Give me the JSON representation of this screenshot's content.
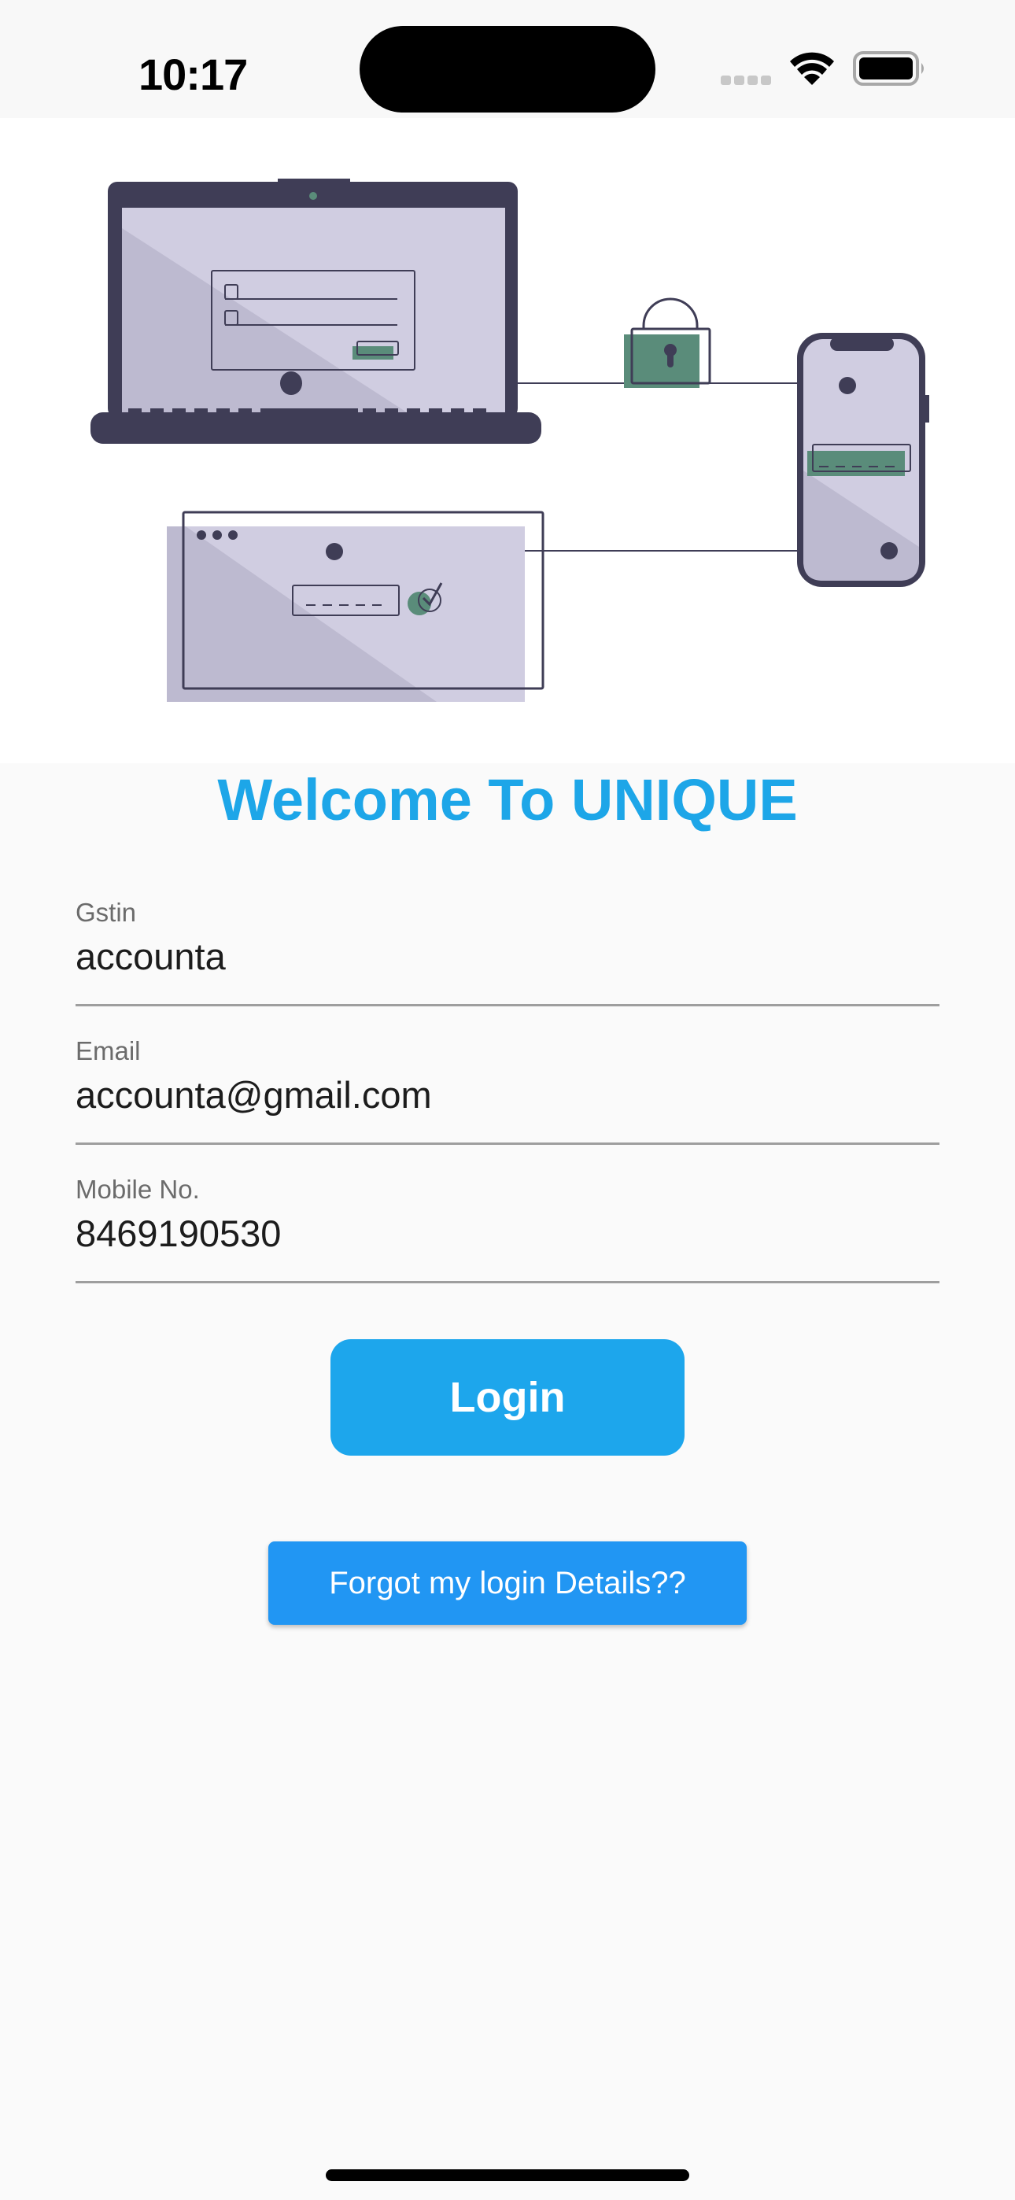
{
  "status_bar": {
    "time": "10:17",
    "icons": [
      "signal-icon",
      "wifi-icon",
      "battery-icon"
    ]
  },
  "illustration": {
    "description": "secure login across devices",
    "colors": {
      "dark": "#3F3D56",
      "screen": "#D0CDE1",
      "screen_shade": "#BDBAD0",
      "accent_green": "#5A8C7A"
    }
  },
  "title": "Welcome To UNIQUE",
  "form": {
    "fields": [
      {
        "label": "Gstin",
        "value": "accounta"
      },
      {
        "label": "Email",
        "value": "accounta@gmail.com"
      },
      {
        "label": "Mobile No.",
        "value": "8469190530"
      }
    ]
  },
  "buttons": {
    "login": "Login",
    "forgot": "Forgot my login Details??"
  },
  "colors": {
    "title": "#1DA6E8",
    "login_button": "#1DA6EC",
    "forgot_button": "#2196F3",
    "underline": "#9E9E9E",
    "background": "#FAFAFA"
  }
}
